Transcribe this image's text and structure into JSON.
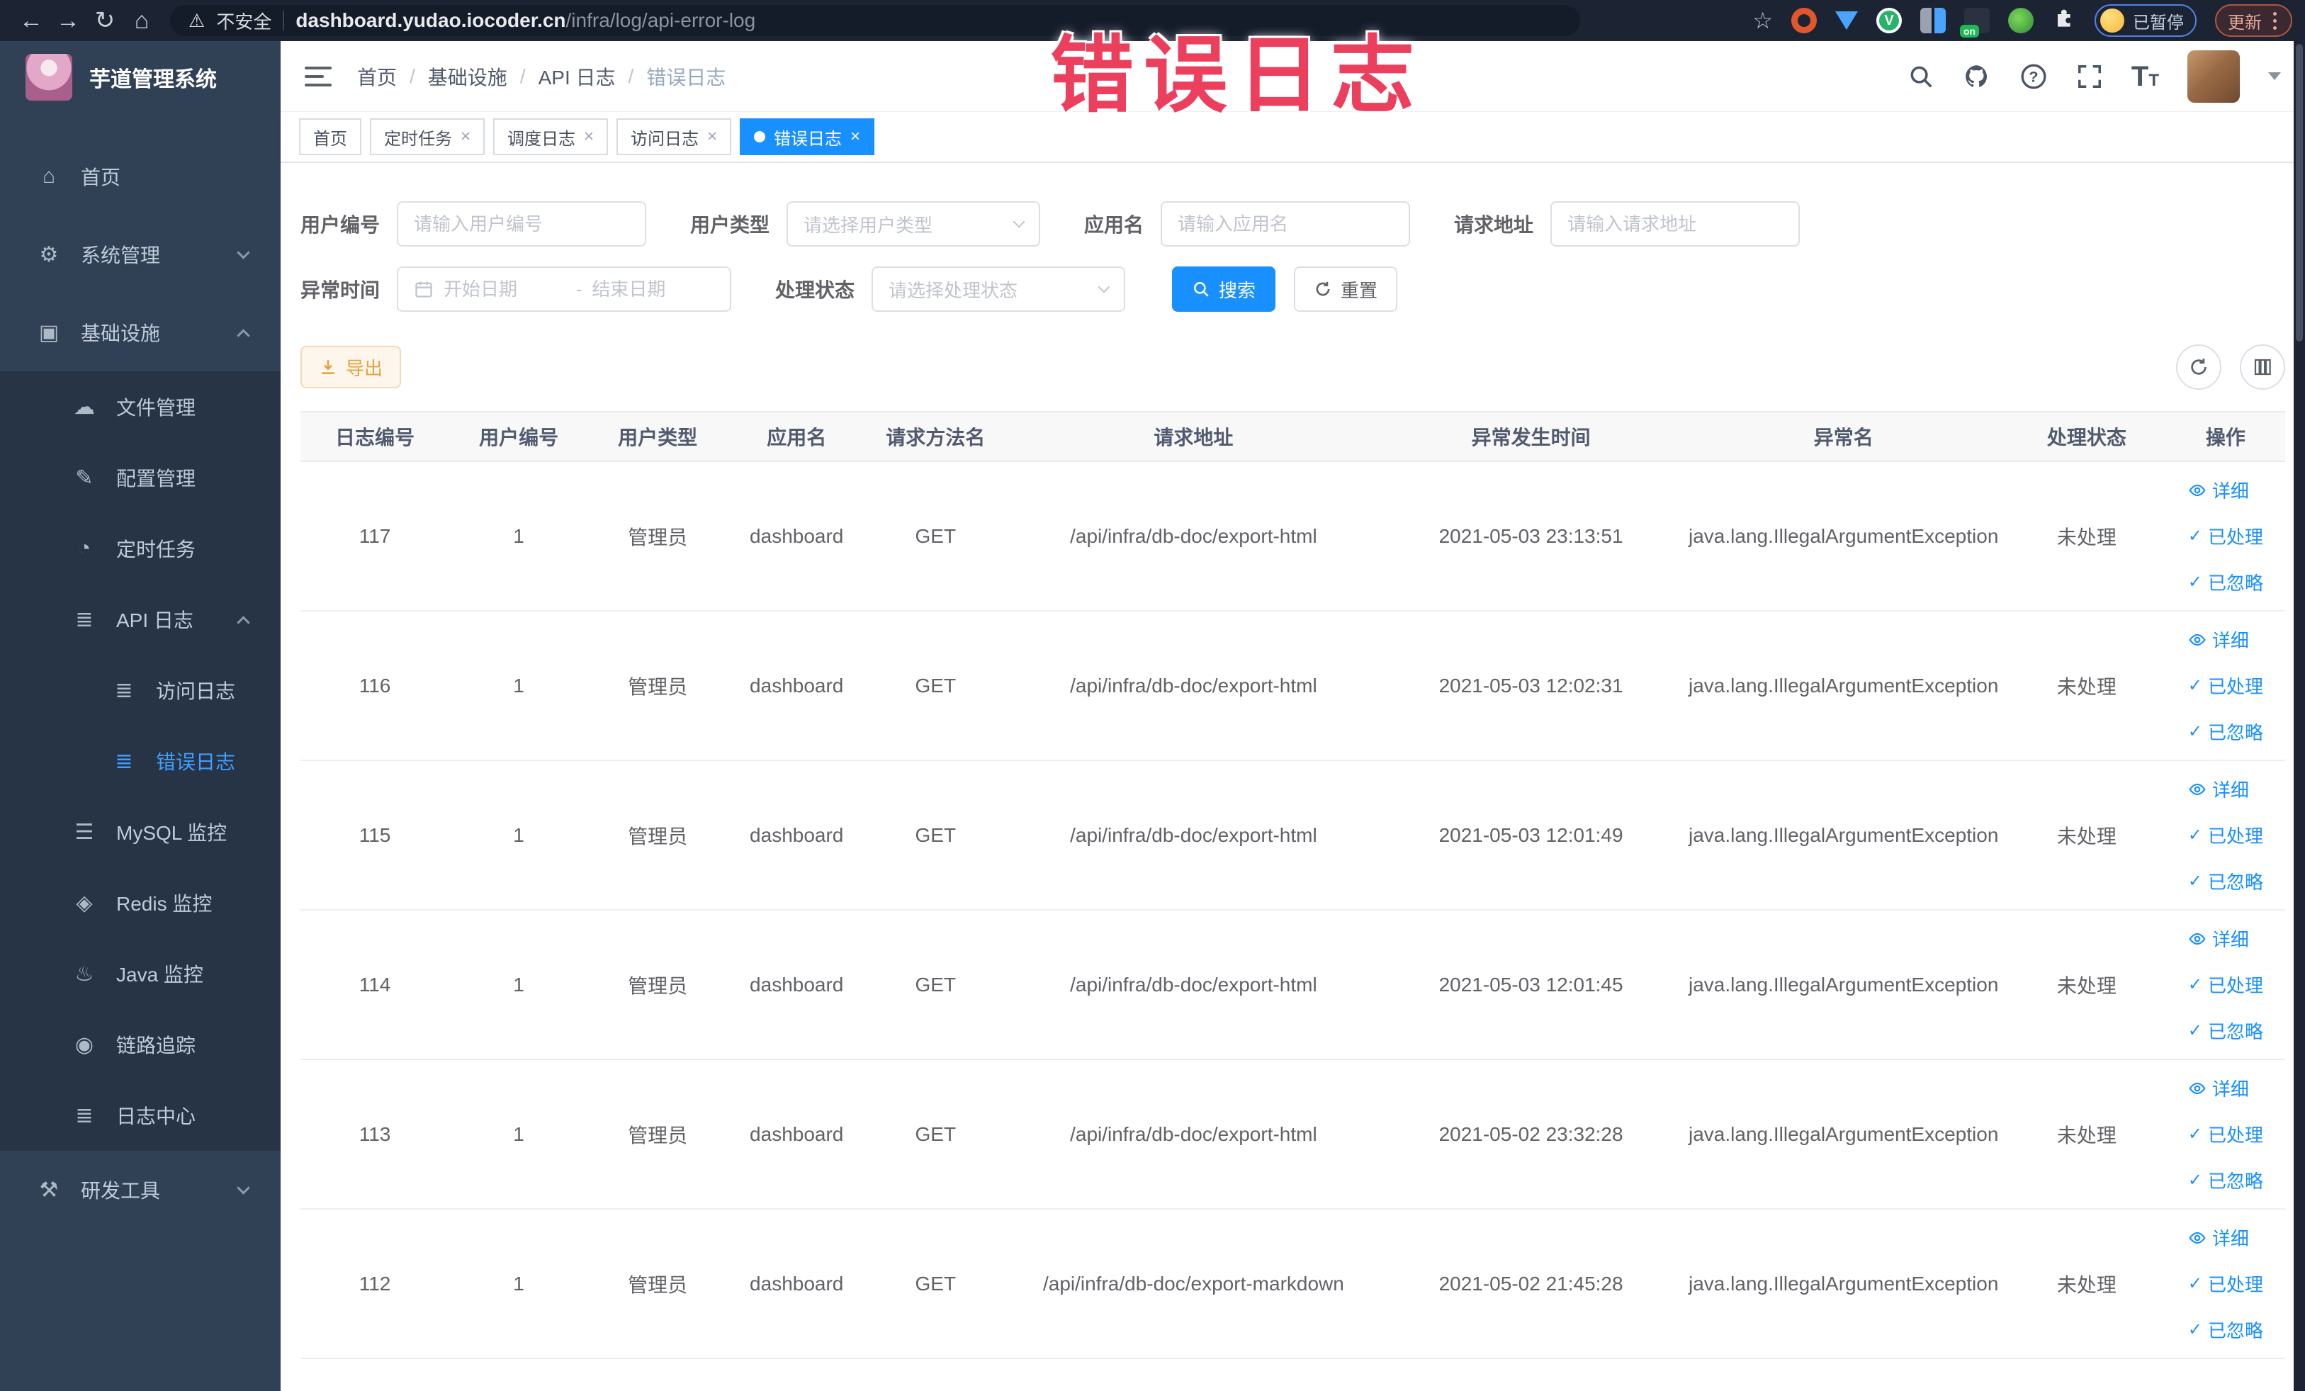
{
  "browser": {
    "security_label": "不安全",
    "url_host": "dashboard.yudao.iocoder.cn",
    "url_path": "/infra/log/api-error-log",
    "profile_label": "已暂停",
    "update_label": "更新",
    "extension_badge": "on"
  },
  "watermark": "错误日志",
  "colors": {
    "accent": "#1890ff",
    "sidebar_active": "#409eff",
    "warning": "#e6a23c",
    "watermark": "#ec3f5d"
  },
  "sidebar": {
    "logo_title": "芋道管理系统",
    "menu": [
      {
        "key": "home",
        "label": "首页",
        "icon": "home-icon",
        "glyph": "⌂",
        "level": 0,
        "group": false
      },
      {
        "key": "system-mgmt",
        "label": "系统管理",
        "icon": "gear-icon",
        "glyph": "⚙",
        "level": 0,
        "group": false,
        "chevron": "down"
      },
      {
        "key": "infrastructure",
        "label": "基础设施",
        "icon": "monitor-icon",
        "glyph": "▣",
        "level": 0,
        "group": false,
        "chevron": "up"
      },
      {
        "key": "file-mgmt",
        "label": "文件管理",
        "icon": "cloud-icon",
        "glyph": "☁",
        "level": 1,
        "group": true
      },
      {
        "key": "config-mgmt",
        "label": "配置管理",
        "icon": "edit-icon",
        "glyph": "✎",
        "level": 1,
        "group": true
      },
      {
        "key": "scheduled-jobs",
        "label": "定时任务",
        "icon": "timer-icon",
        "glyph": "◔",
        "level": 1,
        "group": true
      },
      {
        "key": "api-log",
        "label": "API 日志",
        "icon": "log-icon",
        "glyph": "≣",
        "level": 1,
        "group": true,
        "chevron": "up"
      },
      {
        "key": "access-log",
        "label": "访问日志",
        "icon": "log-icon",
        "glyph": "≣",
        "level": 2,
        "group": true
      },
      {
        "key": "error-log",
        "label": "错误日志",
        "icon": "log-icon",
        "glyph": "≣",
        "level": 2,
        "group": true,
        "active": true
      },
      {
        "key": "mysql-monitor",
        "label": "MySQL 监控",
        "icon": "database-icon",
        "glyph": "☰",
        "level": 1,
        "group": true
      },
      {
        "key": "redis-monitor",
        "label": "Redis 监控",
        "icon": "redis-icon",
        "glyph": "◈",
        "level": 1,
        "group": true
      },
      {
        "key": "java-monitor",
        "label": "Java 监控",
        "icon": "java-icon",
        "glyph": "♨",
        "level": 1,
        "group": true
      },
      {
        "key": "trace",
        "label": "链路追踪",
        "icon": "eye-icon",
        "glyph": "◉",
        "level": 1,
        "group": true
      },
      {
        "key": "log-center",
        "label": "日志中心",
        "icon": "log-icon",
        "glyph": "≣",
        "level": 1,
        "group": true
      },
      {
        "key": "dev-tools",
        "label": "研发工具",
        "icon": "toolbox-icon",
        "glyph": "⚒",
        "level": 0,
        "group": false,
        "chevron": "down"
      }
    ]
  },
  "breadcrumb": [
    "首页",
    "基础设施",
    "API 日志",
    "错误日志"
  ],
  "tabs": [
    {
      "label": "首页",
      "closable": false,
      "active": false
    },
    {
      "label": "定时任务",
      "closable": true,
      "active": false
    },
    {
      "label": "调度日志",
      "closable": true,
      "active": false
    },
    {
      "label": "访问日志",
      "closable": true,
      "active": false
    },
    {
      "label": "错误日志",
      "closable": true,
      "active": true
    }
  ],
  "filters": {
    "row1": [
      {
        "key": "user-id",
        "label": "用户编号",
        "placeholder": "请输入用户编号",
        "type": "input"
      },
      {
        "key": "user-type",
        "label": "用户类型",
        "placeholder": "请选择用户类型",
        "type": "select"
      },
      {
        "key": "app-name",
        "label": "应用名",
        "placeholder": "请输入应用名",
        "type": "input"
      },
      {
        "key": "request-url",
        "label": "请求地址",
        "placeholder": "请输入请求地址",
        "type": "input"
      }
    ],
    "date": {
      "label": "异常时间",
      "start_placeholder": "开始日期",
      "separator": "-",
      "end_placeholder": "结束日期"
    },
    "status": {
      "label": "处理状态",
      "placeholder": "请选择处理状态"
    },
    "search_label": "搜索",
    "reset_label": "重置"
  },
  "toolbar": {
    "export_label": "导出"
  },
  "table": {
    "headers": [
      "日志编号",
      "用户编号",
      "用户类型",
      "应用名",
      "请求方法名",
      "请求地址",
      "异常发生时间",
      "异常名",
      "处理状态",
      "操作"
    ],
    "actions": [
      "详细",
      "已处理",
      "已忽略"
    ],
    "rows": [
      {
        "id": "117",
        "user_id": "1",
        "user_type": "管理员",
        "app": "dashboard",
        "method": "GET",
        "url": "/api/infra/db-doc/export-html",
        "time": "2021-05-03 23:13:51",
        "exception": "java.lang.IllegalArgumentException",
        "status": "未处理"
      },
      {
        "id": "116",
        "user_id": "1",
        "user_type": "管理员",
        "app": "dashboard",
        "method": "GET",
        "url": "/api/infra/db-doc/export-html",
        "time": "2021-05-03 12:02:31",
        "exception": "java.lang.IllegalArgumentException",
        "status": "未处理"
      },
      {
        "id": "115",
        "user_id": "1",
        "user_type": "管理员",
        "app": "dashboard",
        "method": "GET",
        "url": "/api/infra/db-doc/export-html",
        "time": "2021-05-03 12:01:49",
        "exception": "java.lang.IllegalArgumentException",
        "status": "未处理"
      },
      {
        "id": "114",
        "user_id": "1",
        "user_type": "管理员",
        "app": "dashboard",
        "method": "GET",
        "url": "/api/infra/db-doc/export-html",
        "time": "2021-05-03 12:01:45",
        "exception": "java.lang.IllegalArgumentException",
        "status": "未处理"
      },
      {
        "id": "113",
        "user_id": "1",
        "user_type": "管理员",
        "app": "dashboard",
        "method": "GET",
        "url": "/api/infra/db-doc/export-html",
        "time": "2021-05-02 23:32:28",
        "exception": "java.lang.IllegalArgumentException",
        "status": "未处理"
      },
      {
        "id": "112",
        "user_id": "1",
        "user_type": "管理员",
        "app": "dashboard",
        "method": "GET",
        "url": "/api/infra/db-doc/export-markdown",
        "time": "2021-05-02 21:45:28",
        "exception": "java.lang.IllegalArgumentException",
        "status": "未处理"
      }
    ]
  }
}
